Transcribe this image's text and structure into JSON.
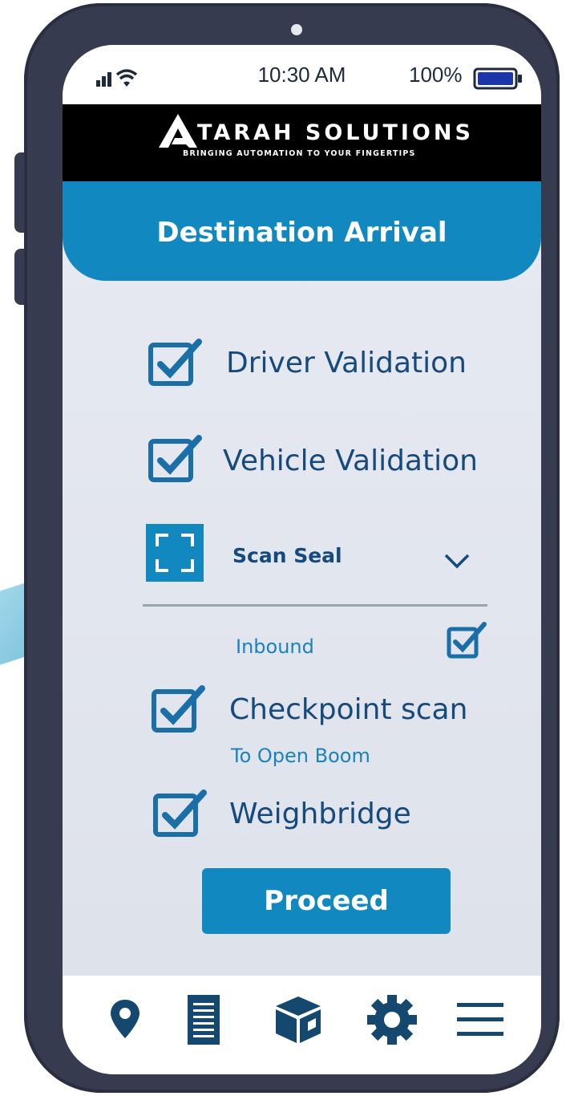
{
  "status_bar": {
    "time": "10:30 AM",
    "battery": "100%"
  },
  "brand": {
    "name": "ATARAH SOLUTIONS",
    "name_rest": "TARAH SOLUTIONS",
    "tagline": "BRINGING AUTOMATION TO YOUR FINGERTIPS"
  },
  "header": {
    "title": "Destination Arrival"
  },
  "checklist": {
    "driver_validation": {
      "label": "Driver Validation",
      "checked": true
    },
    "vehicle_validation": {
      "label": "Vehicle Validation",
      "checked": true
    },
    "scan_seal": {
      "label": "Scan Seal"
    },
    "inbound": {
      "label": "Inbound",
      "checked": true
    },
    "checkpoint_scan": {
      "label": "Checkpoint scan",
      "sublabel": "To Open Boom",
      "checked": true
    },
    "weighbridge": {
      "label": "Weighbridge",
      "checked": true
    }
  },
  "actions": {
    "proceed_label": "Proceed"
  },
  "bottom_nav": {
    "items": [
      "location-pin-icon",
      "document-icon",
      "package-icon",
      "gear-icon",
      "menu-icon"
    ]
  },
  "colors": {
    "accent": "#1189c0",
    "text_dark": "#174a7c",
    "phone_frame": "#363b4f"
  }
}
